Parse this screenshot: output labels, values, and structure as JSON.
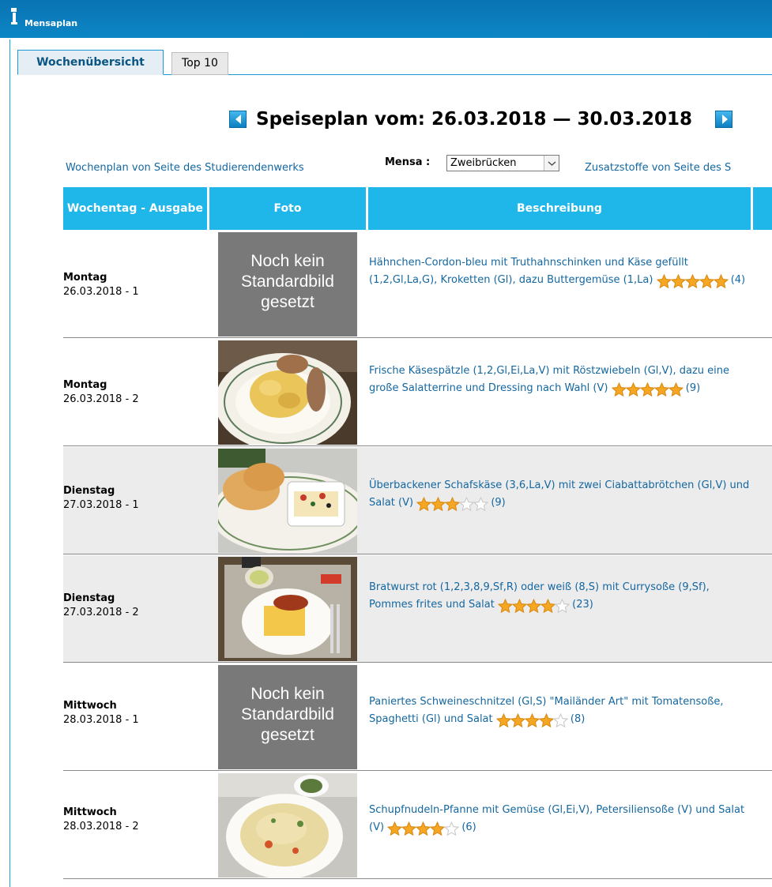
{
  "app": {
    "title": "Mensaplan"
  },
  "tabs": [
    {
      "label": "Wochenübersicht",
      "active": true
    },
    {
      "label": "Top 10",
      "active": false
    }
  ],
  "heading": {
    "text": "Speiseplan vom: 26.03.2018 — 30.03.2018"
  },
  "links": {
    "left": "Wochenplan von Seite des Studierendenwerks",
    "mensa_label": "Mensa :",
    "mensa_value": "Zweibrücken",
    "right": "Zusatzstoffe von Seite des S"
  },
  "table": {
    "headers": [
      "Wochentag - Ausgabe",
      "Foto",
      "Beschreibung"
    ],
    "rows": [
      {
        "day": "Montag",
        "date": "26.03.2018 - 1",
        "photo": "none",
        "no_photo_text": "Noch kein Standardbild gesetzt",
        "desc": "Hähnchen-Cordon-bleu mit Truthahnschinken und Käse gefüllt (1,2,Gl,La,G), Kroketten (Gl), dazu Buttergemüse (1,La)",
        "rating": 5,
        "count": "(4)"
      },
      {
        "day": "Montag",
        "date": "26.03.2018 - 2",
        "photo": "spaetzle",
        "desc": "Frische Käsespätzle (1,2,Gl,Ei,La,V) mit Röstzwiebeln (Gl,V), dazu eine große Salatterrine und Dressing nach Wahl (V)",
        "rating": 5,
        "count": "(9)"
      },
      {
        "day": "Dienstag",
        "date": "27.03.2018 - 1",
        "photo": "feta",
        "desc": "Überbackener Schafskäse (3,6,La,V) mit zwei Ciabattabrötchen (Gl,V) und Salat (V)",
        "rating": 3,
        "count": "(9)"
      },
      {
        "day": "Dienstag",
        "date": "27.03.2018 - 2",
        "photo": "currywurst",
        "desc": "Bratwurst rot (1,2,3,8,9,Sf,R) oder weiß (8,S) mit Currysoße (9,Sf), Pommes frites und Salat",
        "rating": 4,
        "count": "(23)"
      },
      {
        "day": "Mittwoch",
        "date": "28.03.2018 - 1",
        "photo": "none",
        "no_photo_text": "Noch kein Standardbild gesetzt",
        "desc": "Paniertes Schweineschnitzel (Gl,S) \"Mailänder Art\" mit Tomatensoße, Spaghetti (Gl) und Salat",
        "rating": 4,
        "count": "(8)"
      },
      {
        "day": "Mittwoch",
        "date": "28.03.2018 - 2",
        "photo": "schupfnudeln",
        "desc": "Schupfnudeln-Pfanne mit Gemüse (Gl,Ei,V), Petersiliensoße (V) und Salat (V)",
        "rating": 4,
        "count": "(6)"
      }
    ]
  },
  "colors": {
    "titlebar": "#0a73b2",
    "header": "#1fb6ea",
    "link": "#1467a0",
    "star": "#f5a623",
    "no_photo_bg": "#797979"
  }
}
